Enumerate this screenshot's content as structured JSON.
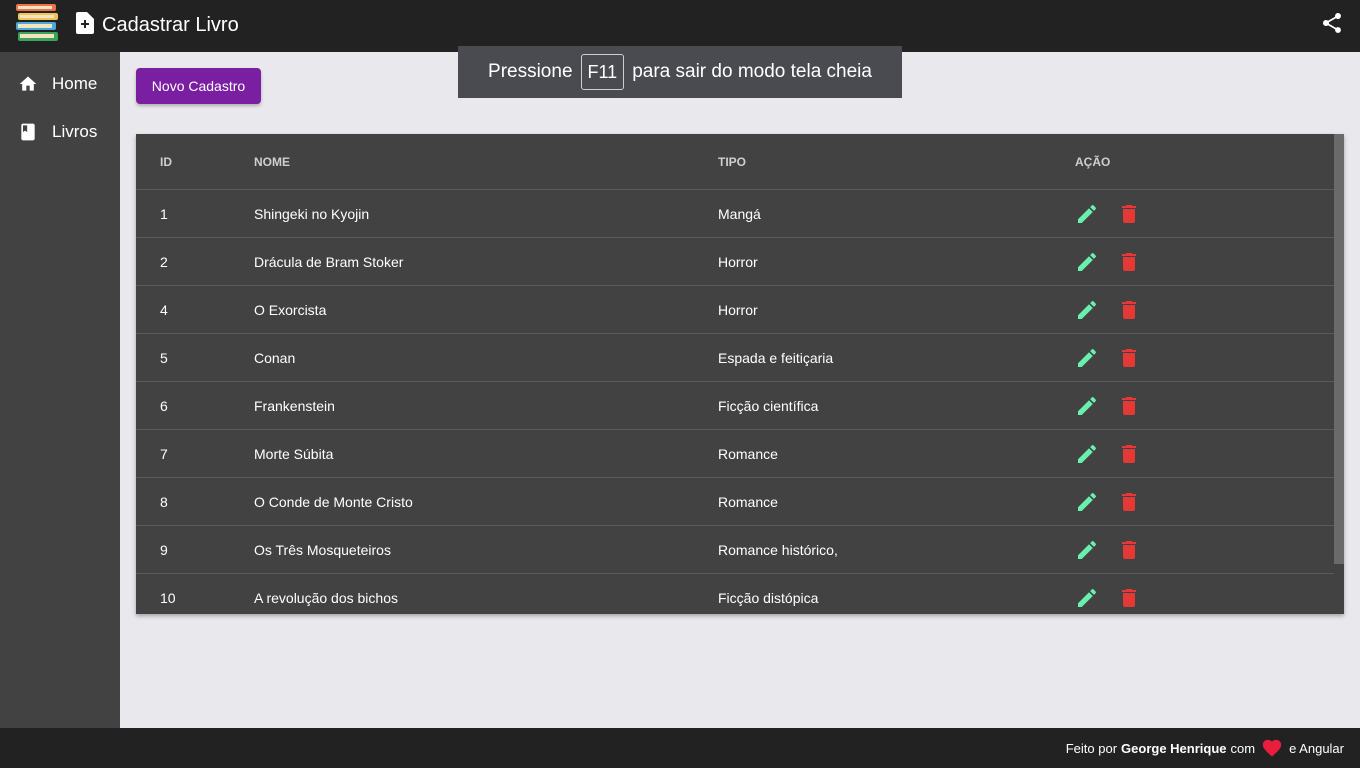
{
  "app": {
    "title": "Cadastrar Livro"
  },
  "fullscreen_hint": {
    "before": "Pressione",
    "key": "F11",
    "after": "para sair do modo tela cheia"
  },
  "sidebar": {
    "items": [
      {
        "label": "Home",
        "icon": "home-icon"
      },
      {
        "label": "Livros",
        "icon": "book-icon"
      }
    ]
  },
  "toolbar": {
    "new_label": "Novo Cadastro"
  },
  "table": {
    "headers": {
      "id": "ID",
      "name": "NOME",
      "type": "TIPO",
      "action": "AÇÃO"
    },
    "rows": [
      {
        "id": "1",
        "name": "Shingeki no Kyojin",
        "type": "Mangá"
      },
      {
        "id": "2",
        "name": "Drácula de Bram Stoker",
        "type": "Horror"
      },
      {
        "id": "4",
        "name": "O Exorcista",
        "type": "Horror"
      },
      {
        "id": "5",
        "name": "Conan",
        "type": "Espada e feitiçaria"
      },
      {
        "id": "6",
        "name": "Frankenstein",
        "type": "Ficção científica"
      },
      {
        "id": "7",
        "name": "Morte Súbita",
        "type": "Romance"
      },
      {
        "id": "8",
        "name": "O Conde de Monte Cristo",
        "type": "Romance"
      },
      {
        "id": "9",
        "name": "Os Três Mosqueteiros",
        "type": "Romance histórico,"
      },
      {
        "id": "10",
        "name": "A revolução dos bichos",
        "type": "Ficção distópica"
      }
    ]
  },
  "footer": {
    "prefix": "Feito por",
    "author": "George Henrique",
    "middle": "com",
    "suffix": "e Angular"
  },
  "colors": {
    "accent": "#7b1fa2",
    "edit": "#69f0ae",
    "delete": "#e53935",
    "heart": "#e91e3c"
  }
}
